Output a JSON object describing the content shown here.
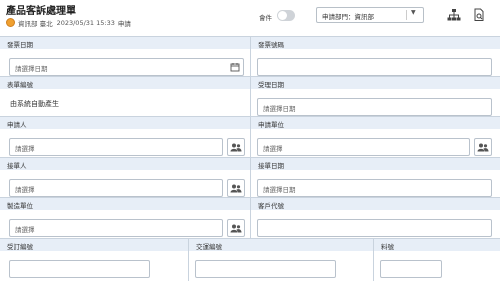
{
  "header": {
    "title": "產品客訴處理單",
    "user": "資訊部 臺北",
    "datetime": "2023/05/31 15:33",
    "status": "申請",
    "toggle_label": "會件",
    "dept_select": "申請部門：資訊部"
  },
  "form": {
    "invoice_date": {
      "label": "發票日期",
      "placeholder": "請選擇日期"
    },
    "invoice_no": {
      "label": "發票號碼",
      "placeholder": ""
    },
    "form_no": {
      "label": "表單編號",
      "value": "由系統自動產生"
    },
    "accept_date": {
      "label": "受理日期",
      "placeholder": "請選擇日期"
    },
    "applicant": {
      "label": "申請人",
      "placeholder": "請選擇"
    },
    "apply_unit": {
      "label": "申請單位",
      "placeholder": "請選擇"
    },
    "receiver": {
      "label": "接單人",
      "placeholder": "請選擇"
    },
    "receive_date": {
      "label": "接單日期",
      "placeholder": "請選擇日期"
    },
    "mfg_unit": {
      "label": "製造單位",
      "placeholder": "請選擇"
    },
    "customer_code": {
      "label": "客戶代號",
      "placeholder": ""
    },
    "order_no": {
      "label": "受訂編號"
    },
    "delivery_no": {
      "label": "交運編號"
    },
    "part_no": {
      "label": "料號"
    }
  }
}
